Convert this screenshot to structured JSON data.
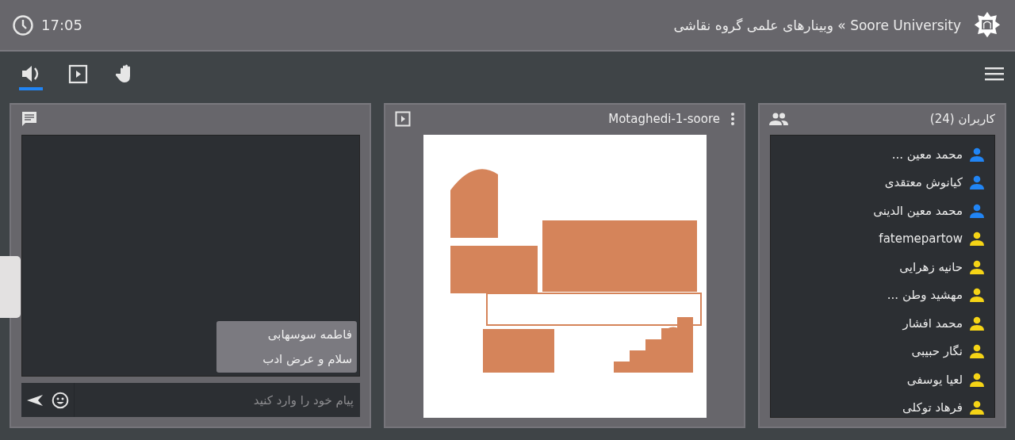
{
  "header": {
    "time": "17:05",
    "title": "Soore University » وبینارهای علمی گروه نقاشی"
  },
  "toolbar": [
    {
      "kind": "audio",
      "selected": true
    },
    {
      "kind": "presentation",
      "selected": false
    },
    {
      "kind": "hand",
      "selected": false
    }
  ],
  "chat": {
    "messages": [
      {
        "sender": "فاطمه سوسهابی",
        "text": "سلام و عرض ادب"
      }
    ],
    "input": {
      "placeholder": "پیام خود را وارد کنید"
    }
  },
  "presentation": {
    "title": "Motaghedi-1-soore"
  },
  "users": {
    "title": "کاربران (24)",
    "items": [
      {
        "name": "محمد معین ...",
        "color": "#2185f5"
      },
      {
        "name": "کیانوش معتقدی",
        "color": "#2185f5"
      },
      {
        "name": "محمد معین الدینی",
        "color": "#2185f5"
      },
      {
        "name": "fatemepartow",
        "color": "#f5d416"
      },
      {
        "name": "حانیه زهرایی",
        "color": "#f5d416"
      },
      {
        "name": "مهشید وطن ...",
        "color": "#f5d416"
      },
      {
        "name": "محمد افشار",
        "color": "#f5d416"
      },
      {
        "name": "نگار حبیبی",
        "color": "#f5d416"
      },
      {
        "name": "لعیا یوسفی",
        "color": "#f5d416"
      },
      {
        "name": "فرهاد توکلی",
        "color": "#f5d416"
      }
    ]
  }
}
